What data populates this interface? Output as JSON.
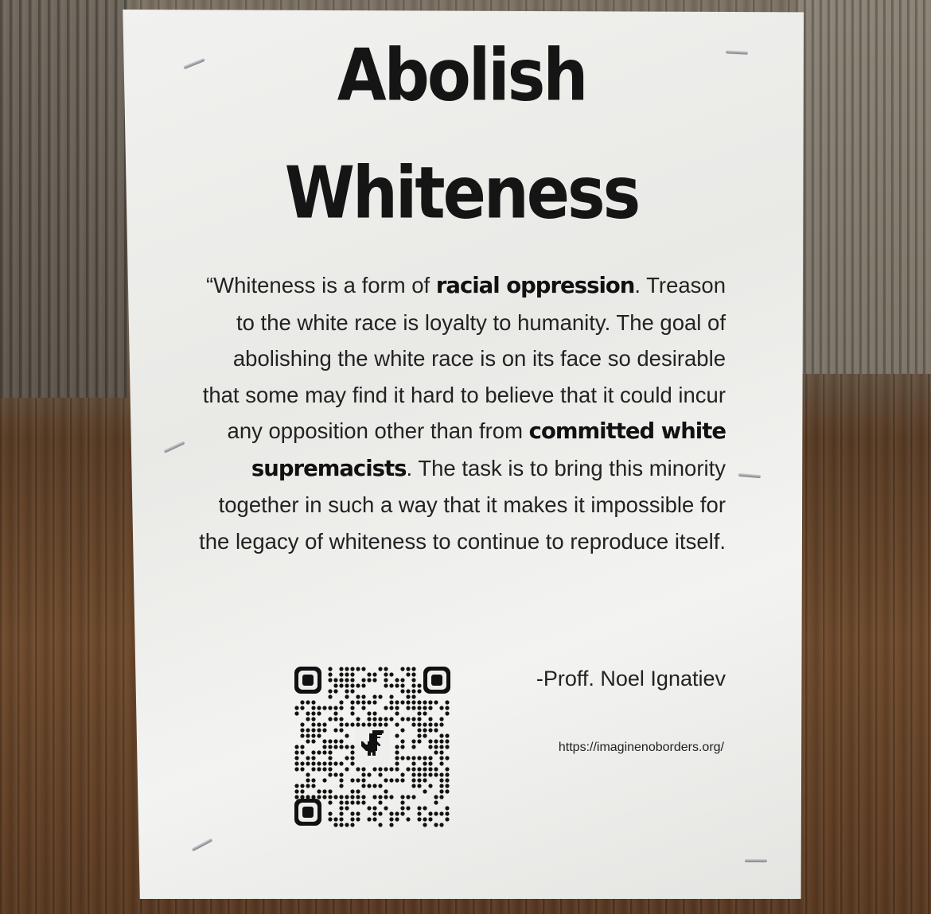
{
  "poster": {
    "title_line1": "Abolish",
    "title_line2": "Whiteness",
    "quote": {
      "seg1": "“Whiteness is a form of ",
      "emph1": "racial oppression",
      "seg2": ". Treason to the white race is loyalty to humanity. The goal of abolishing the white race is on its face so desirable that some may find it hard to believe that it could incur any opposition other than from ",
      "emph2": "committed white supremacists",
      "seg3": ". The task is to bring this minority together in such a way that it makes it impossible for the legacy of whiteness to continue to reproduce itself."
    },
    "attribution": "-Proff. Noel Ignatiev",
    "url": "https://imaginenoborders.org/"
  },
  "colors": {
    "paper": "#eeeeec",
    "ink": "#151515",
    "wood_dark": "#5b3a22",
    "wood_grey": "#7b7366"
  },
  "icons": {
    "qr_code": "qr-code-icon",
    "dinosaur": "dinosaur-icon"
  }
}
